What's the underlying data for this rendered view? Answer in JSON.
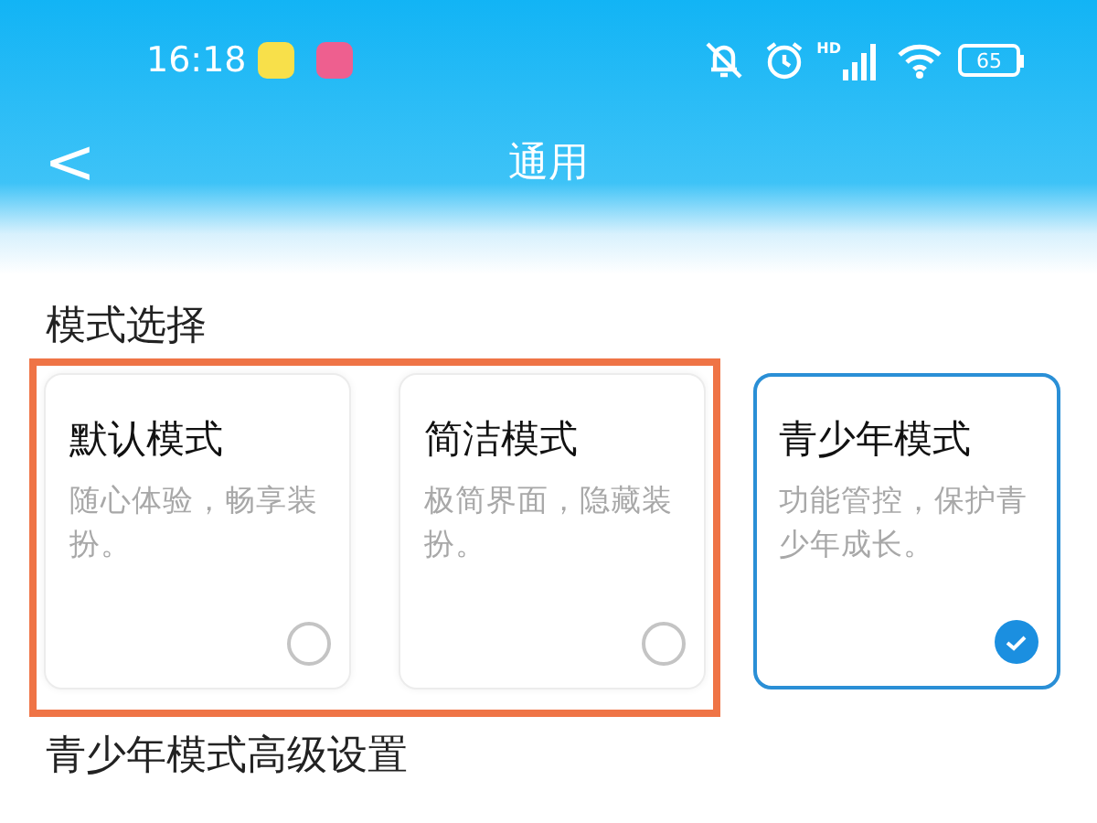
{
  "status_bar": {
    "time": "16:18",
    "network": "HD",
    "battery": "65"
  },
  "nav": {
    "back": "<",
    "title": "通用"
  },
  "section_title": "模式选择",
  "modes": [
    {
      "title": "默认模式",
      "description": "随心体验，畅享装扮。",
      "selected": false
    },
    {
      "title": "简洁模式",
      "description": "极简界面，隐藏装扮。",
      "selected": false
    },
    {
      "title": "青少年模式",
      "description": "功能管控，保护青少年成长。",
      "selected": true
    }
  ],
  "advanced_title": "青少年模式高级设置"
}
